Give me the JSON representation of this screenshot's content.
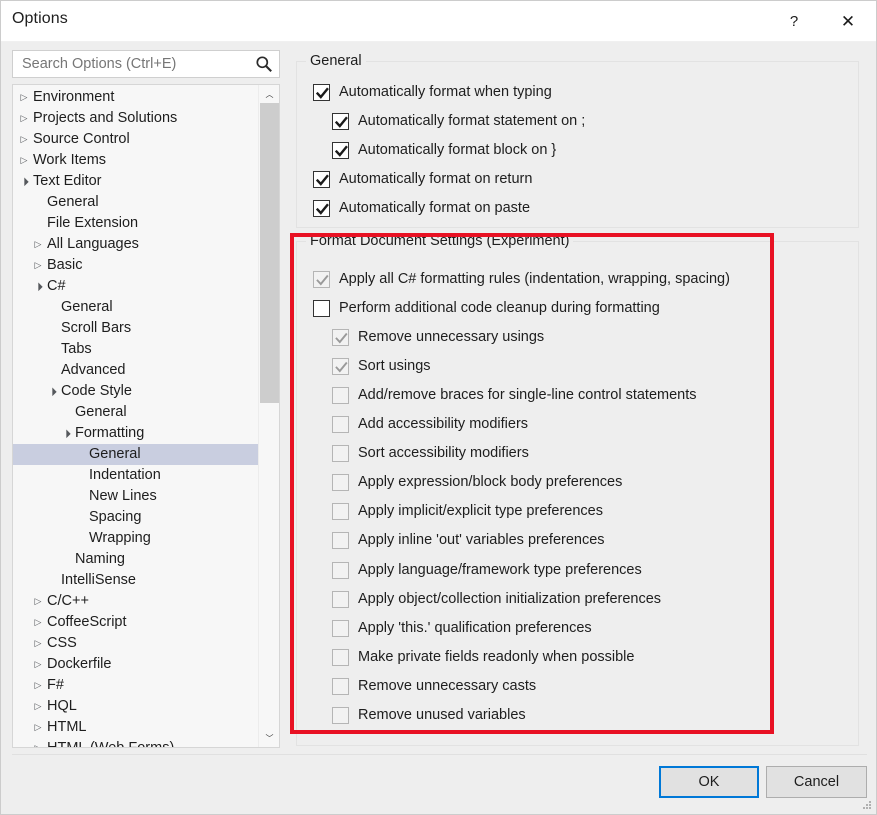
{
  "window": {
    "title": "Options",
    "help_label": "?",
    "close_label": "✕"
  },
  "search": {
    "placeholder": "Search Options (Ctrl+E)",
    "value": "",
    "icon": "search-icon"
  },
  "sidebar": {
    "scrollbar": {
      "up_glyph": "︿",
      "down_glyph": "﹀"
    },
    "items": [
      {
        "label": "Environment",
        "depth": 0,
        "arrow": "collapsed",
        "selected": false
      },
      {
        "label": "Projects and Solutions",
        "depth": 0,
        "arrow": "collapsed",
        "selected": false
      },
      {
        "label": "Source Control",
        "depth": 0,
        "arrow": "collapsed",
        "selected": false
      },
      {
        "label": "Work Items",
        "depth": 0,
        "arrow": "collapsed",
        "selected": false
      },
      {
        "label": "Text Editor",
        "depth": 0,
        "arrow": "expanded",
        "selected": false
      },
      {
        "label": "General",
        "depth": 1,
        "arrow": "none",
        "selected": false
      },
      {
        "label": "File Extension",
        "depth": 1,
        "arrow": "none",
        "selected": false
      },
      {
        "label": "All Languages",
        "depth": 1,
        "arrow": "collapsed",
        "selected": false
      },
      {
        "label": "Basic",
        "depth": 1,
        "arrow": "collapsed",
        "selected": false
      },
      {
        "label": "C#",
        "depth": 1,
        "arrow": "expanded",
        "selected": false
      },
      {
        "label": "General",
        "depth": 2,
        "arrow": "none",
        "selected": false
      },
      {
        "label": "Scroll Bars",
        "depth": 2,
        "arrow": "none",
        "selected": false
      },
      {
        "label": "Tabs",
        "depth": 2,
        "arrow": "none",
        "selected": false
      },
      {
        "label": "Advanced",
        "depth": 2,
        "arrow": "none",
        "selected": false
      },
      {
        "label": "Code Style",
        "depth": 2,
        "arrow": "expanded",
        "selected": false
      },
      {
        "label": "General",
        "depth": 3,
        "arrow": "none",
        "selected": false
      },
      {
        "label": "Formatting",
        "depth": 3,
        "arrow": "expanded",
        "selected": false
      },
      {
        "label": "General",
        "depth": 4,
        "arrow": "none",
        "selected": true
      },
      {
        "label": "Indentation",
        "depth": 4,
        "arrow": "none",
        "selected": false
      },
      {
        "label": "New Lines",
        "depth": 4,
        "arrow": "none",
        "selected": false
      },
      {
        "label": "Spacing",
        "depth": 4,
        "arrow": "none",
        "selected": false
      },
      {
        "label": "Wrapping",
        "depth": 4,
        "arrow": "none",
        "selected": false
      },
      {
        "label": "Naming",
        "depth": 3,
        "arrow": "none",
        "selected": false
      },
      {
        "label": "IntelliSense",
        "depth": 2,
        "arrow": "none",
        "selected": false
      },
      {
        "label": "C/C++",
        "depth": 1,
        "arrow": "collapsed",
        "selected": false
      },
      {
        "label": "CoffeeScript",
        "depth": 1,
        "arrow": "collapsed",
        "selected": false
      },
      {
        "label": "CSS",
        "depth": 1,
        "arrow": "collapsed",
        "selected": false
      },
      {
        "label": "Dockerfile",
        "depth": 1,
        "arrow": "collapsed",
        "selected": false
      },
      {
        "label": "F#",
        "depth": 1,
        "arrow": "collapsed",
        "selected": false
      },
      {
        "label": "HQL",
        "depth": 1,
        "arrow": "collapsed",
        "selected": false
      },
      {
        "label": "HTML",
        "depth": 1,
        "arrow": "collapsed",
        "selected": false
      },
      {
        "label": "HTML (Web Forms)",
        "depth": 1,
        "arrow": "collapsed",
        "selected": false
      }
    ]
  },
  "general_group": {
    "legend": "General",
    "options": [
      {
        "label": "Automatically format when typing",
        "checked": true,
        "enabled": true,
        "indent": 0
      },
      {
        "label": "Automatically format statement on ;",
        "checked": true,
        "enabled": true,
        "indent": 1
      },
      {
        "label": "Automatically format block on }",
        "checked": true,
        "enabled": true,
        "indent": 1
      },
      {
        "label": "Automatically format on return",
        "checked": true,
        "enabled": true,
        "indent": 0
      },
      {
        "label": "Automatically format on paste",
        "checked": true,
        "enabled": true,
        "indent": 0
      }
    ]
  },
  "format_document_group": {
    "legend": "Format Document Settings (Experiment)",
    "options": [
      {
        "label": "Apply all C# formatting rules (indentation, wrapping, spacing)",
        "checked": true,
        "enabled": false,
        "indent": 0
      },
      {
        "label": "Perform additional code cleanup during formatting",
        "checked": false,
        "enabled": true,
        "indent": 0
      },
      {
        "label": "Remove unnecessary usings",
        "checked": true,
        "enabled": false,
        "indent": 1
      },
      {
        "label": "Sort usings",
        "checked": true,
        "enabled": false,
        "indent": 1
      },
      {
        "label": "Add/remove braces for single-line control statements",
        "checked": false,
        "enabled": false,
        "indent": 1
      },
      {
        "label": "Add accessibility modifiers",
        "checked": false,
        "enabled": false,
        "indent": 1
      },
      {
        "label": "Sort accessibility modifiers",
        "checked": false,
        "enabled": false,
        "indent": 1
      },
      {
        "label": "Apply expression/block body preferences",
        "checked": false,
        "enabled": false,
        "indent": 1
      },
      {
        "label": "Apply implicit/explicit type preferences",
        "checked": false,
        "enabled": false,
        "indent": 1
      },
      {
        "label": "Apply inline 'out' variables preferences",
        "checked": false,
        "enabled": false,
        "indent": 1
      },
      {
        "label": "Apply language/framework type preferences",
        "checked": false,
        "enabled": false,
        "indent": 1
      },
      {
        "label": "Apply object/collection initialization preferences",
        "checked": false,
        "enabled": false,
        "indent": 1
      },
      {
        "label": "Apply 'this.' qualification preferences",
        "checked": false,
        "enabled": false,
        "indent": 1
      },
      {
        "label": "Make private fields readonly when possible",
        "checked": false,
        "enabled": false,
        "indent": 1
      },
      {
        "label": "Remove unnecessary casts",
        "checked": false,
        "enabled": false,
        "indent": 1
      },
      {
        "label": "Remove unused variables",
        "checked": false,
        "enabled": false,
        "indent": 1
      }
    ]
  },
  "annotation": {
    "highlight_color": "#e81123",
    "target": "format_document_group"
  },
  "footer": {
    "ok_label": "OK",
    "cancel_label": "Cancel"
  }
}
